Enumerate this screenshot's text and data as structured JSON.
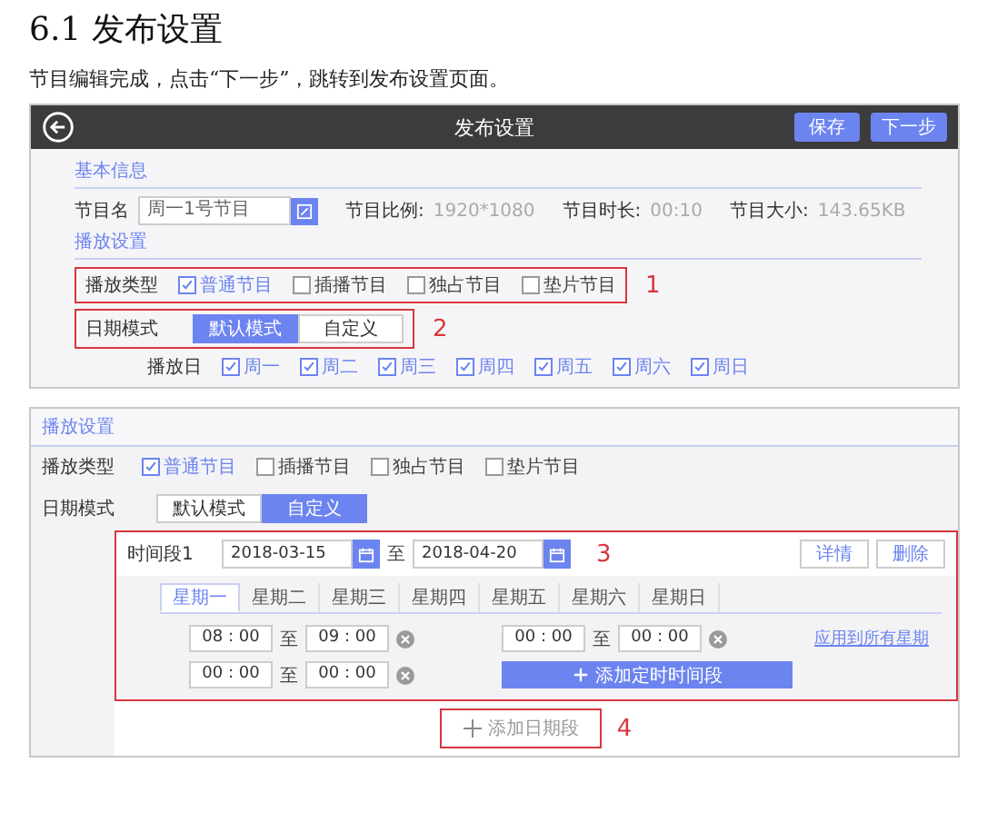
{
  "heading": "6.1 发布设置",
  "intro": "节目编辑完成，点击“下一步”，跳转到发布设置页面。",
  "screenshot_1": {
    "title": "发布设置",
    "buttons": [
      "保存",
      "下一步"
    ],
    "basic_section": "基本信息",
    "name_label": "节目名",
    "name_value": "周一1号节目",
    "stats": [
      {
        "label": "节目比例:",
        "value": "1920*1080"
      },
      {
        "label": "节目时长:",
        "value": "00:10"
      },
      {
        "label": "节目大小:",
        "value": "143.65KB"
      }
    ],
    "play_section": "播放设置",
    "play_type": {
      "label": "播放类型",
      "annotation": "1",
      "options": [
        {
          "label": "普通节目",
          "checked": true
        },
        {
          "label": "插播节目",
          "checked": false
        },
        {
          "label": "独占节目",
          "checked": false
        },
        {
          "label": "垫片节目",
          "checked": false
        }
      ]
    },
    "date_mode": {
      "label": "日期模式",
      "annotation": "2",
      "options": [
        {
          "label": "默认模式",
          "selected": true
        },
        {
          "label": "自定义",
          "selected": false
        }
      ]
    },
    "play_days": {
      "label": "播放日",
      "days": [
        {
          "label": "周一",
          "checked": true
        },
        {
          "label": "周二",
          "checked": true
        },
        {
          "label": "周三",
          "checked": true
        },
        {
          "label": "周四",
          "checked": true
        },
        {
          "label": "周五",
          "checked": true
        },
        {
          "label": "周六",
          "checked": true
        },
        {
          "label": "周日",
          "checked": true
        }
      ]
    }
  },
  "screenshot_2": {
    "section": "播放设置",
    "play_type": {
      "label": "播放类型",
      "options": [
        {
          "label": "普通节目",
          "checked": true
        },
        {
          "label": "插播节目",
          "checked": false
        },
        {
          "label": "独占节目",
          "checked": false
        },
        {
          "label": "垫片节目",
          "checked": false
        }
      ]
    },
    "date_mode": {
      "label": "日期模式",
      "options": [
        {
          "label": "默认模式",
          "selected": false
        },
        {
          "label": "自定义",
          "selected": true
        }
      ]
    },
    "period": {
      "label": "时间段1",
      "start": "2018-03-15",
      "to": "至",
      "end": "2018-04-20",
      "annotation": "3",
      "buttons": [
        "详情",
        "删除"
      ],
      "weekdays": [
        {
          "label": "星期一",
          "selected": true
        },
        {
          "label": "星期二",
          "selected": false
        },
        {
          "label": "星期三",
          "selected": false
        },
        {
          "label": "星期四",
          "selected": false
        },
        {
          "label": "星期五",
          "selected": false
        },
        {
          "label": "星期六",
          "selected": false
        },
        {
          "label": "星期日",
          "selected": false
        }
      ],
      "slots": [
        {
          "start": "08 : 00",
          "to": "至",
          "end": "09 : 00"
        },
        {
          "start": "00 : 00",
          "to": "至",
          "end": "00 : 00"
        },
        {
          "start": "00 : 00",
          "to": "至",
          "end": "00 : 00"
        }
      ],
      "apply_link": "应用到所有星期",
      "add_slot": "添加定时时间段"
    },
    "add_period": {
      "label": "添加日期段",
      "annotation": "4"
    }
  }
}
